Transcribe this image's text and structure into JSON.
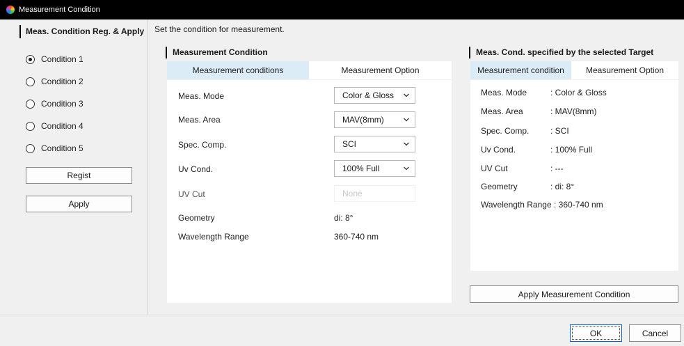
{
  "window": {
    "title": "Measurement Condition"
  },
  "left": {
    "header": "Meas. Condition Reg. & Apply",
    "conditions": [
      "Condition 1",
      "Condition 2",
      "Condition 3",
      "Condition 4",
      "Condition 5"
    ],
    "selected_index": 0,
    "regist_label": "Regist",
    "apply_label": "Apply"
  },
  "instruction": "Set the condition for measurement.",
  "measurement": {
    "title": "Measurement Condition",
    "tabs": [
      "Measurement conditions",
      "Measurement Option"
    ],
    "active_tab": 0,
    "rows": [
      {
        "label": "Meas. Mode",
        "value": "Color & Gloss",
        "type": "select"
      },
      {
        "label": "Meas. Area",
        "value": "MAV(8mm)",
        "type": "select"
      },
      {
        "label": "Spec. Comp.",
        "value": "SCI",
        "type": "select"
      },
      {
        "label": "Uv Cond.",
        "value": "100% Full",
        "type": "select"
      },
      {
        "label": "UV Cut",
        "value": "None",
        "type": "select-disabled"
      },
      {
        "label": "Geometry",
        "value": "di: 8°",
        "type": "text"
      },
      {
        "label": "Wavelength Range",
        "value": "360-740 nm",
        "type": "text"
      }
    ]
  },
  "target": {
    "title": "Meas. Cond. specified by the selected Target",
    "tabs": [
      "Measurement condition",
      "Measurement Option"
    ],
    "active_tab": 0,
    "rows": [
      {
        "label": "Meas. Mode",
        "value": ": Color & Gloss"
      },
      {
        "label": "Meas. Area",
        "value": ": MAV(8mm)"
      },
      {
        "label": "Spec. Comp.",
        "value": ": SCI"
      },
      {
        "label": "Uv Cond.",
        "value": ": 100% Full"
      },
      {
        "label": "UV Cut",
        "value": ": ---"
      },
      {
        "label": "Geometry",
        "value": ": di: 8°"
      },
      {
        "label": "Wavelength Range",
        "value": ": 360-740 nm"
      }
    ],
    "apply_label": "Apply Measurement Condition"
  },
  "footer": {
    "ok_label": "OK",
    "cancel_label": "Cancel"
  },
  "colors": {
    "active_tab": "#dcecf7",
    "ok_border": "#0a64c8",
    "titlebar": "#000000"
  }
}
